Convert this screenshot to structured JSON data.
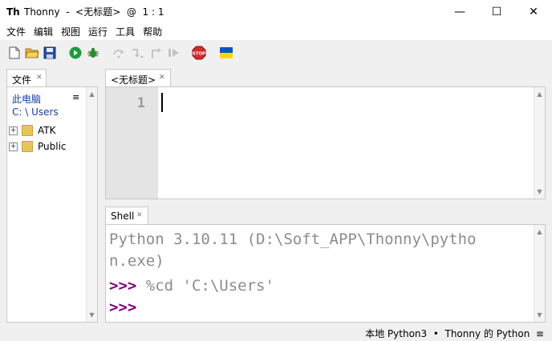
{
  "window": {
    "app_name": "Thonny",
    "title": "Thonny  -  <无标题>  @  1 : 1",
    "controls": {
      "minimize": "—",
      "maximize": "☐",
      "close": "✕"
    }
  },
  "menu": {
    "items": [
      "文件",
      "编辑",
      "视图",
      "运行",
      "工具",
      "帮助"
    ]
  },
  "toolbar": {
    "buttons": [
      "new-file",
      "open-file",
      "save-file",
      "run",
      "debug",
      "step-over",
      "step-into",
      "step-out",
      "resume",
      "stop",
      "ukraine-flag"
    ],
    "stop_label": "STOP",
    "colors": {
      "run": "#1e9b3c",
      "stop": "#d12a2a",
      "flag_blue": "#0057b7",
      "flag_yellow": "#ffd700"
    }
  },
  "files": {
    "tab_label": "文件",
    "location_label": "此电脑",
    "path": "C: \\ Users",
    "menu_icon": "≡",
    "entries": [
      {
        "name": "ATK",
        "expander": "+"
      },
      {
        "name": "Public",
        "expander": "+"
      }
    ]
  },
  "editor": {
    "tab_label": "<无标题>",
    "line_numbers": [
      "1"
    ]
  },
  "shell": {
    "tab_label": "Shell",
    "lines": [
      {
        "text": "Python 3.10.11 (D:\\Soft_APP\\Thonny\\pytho",
        "kind": "banner"
      },
      {
        "text": "n.exe)",
        "kind": "banner"
      },
      {
        "prompt": ">>>",
        "command": " %cd 'C:\\Users'"
      },
      {
        "prompt": ">>>",
        "command": ""
      }
    ]
  },
  "statusbar": {
    "text": "本地 Python3  •  Thonny 的 Python  ≡"
  }
}
